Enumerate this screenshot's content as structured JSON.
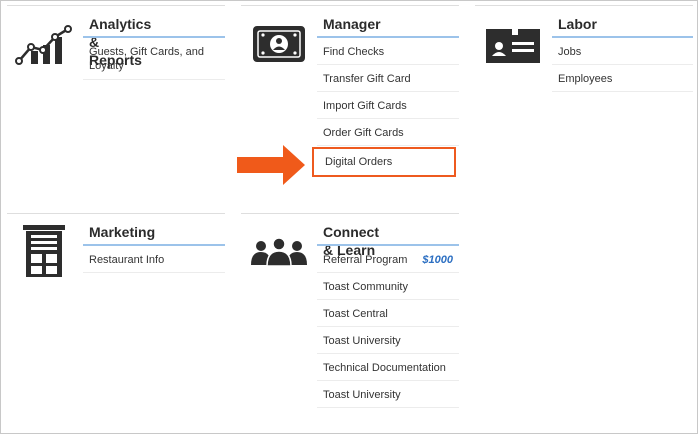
{
  "sections": {
    "analytics": {
      "title": "Analytics & Reports",
      "icon": "line-chart-icon",
      "items": [
        "Guests, Gift Cards, and Loyalty"
      ]
    },
    "manager": {
      "title": "Manager",
      "icon": "cash-bill-icon",
      "items": [
        "Find Checks",
        "Transfer Gift Card",
        "Import Gift Cards",
        "Order Gift Cards",
        "Digital Orders"
      ]
    },
    "labor": {
      "title": "Labor",
      "icon": "id-card-icon",
      "items": [
        "Jobs",
        "Employees"
      ]
    },
    "marketing": {
      "title": "Marketing",
      "icon": "storefront-icon",
      "items": [
        "Restaurant Info"
      ]
    },
    "connect": {
      "title": "Connect & Learn",
      "icon": "people-group-icon",
      "items": [
        "Referral Program",
        "Toast Community",
        "Toast Central",
        "Toast University",
        "Technical Documentation",
        "Toast University"
      ],
      "referral_badge": "$1000"
    }
  },
  "annotation": {
    "arrow": "orange-arrow-icon",
    "highlight_color": "#ee5a1f"
  }
}
